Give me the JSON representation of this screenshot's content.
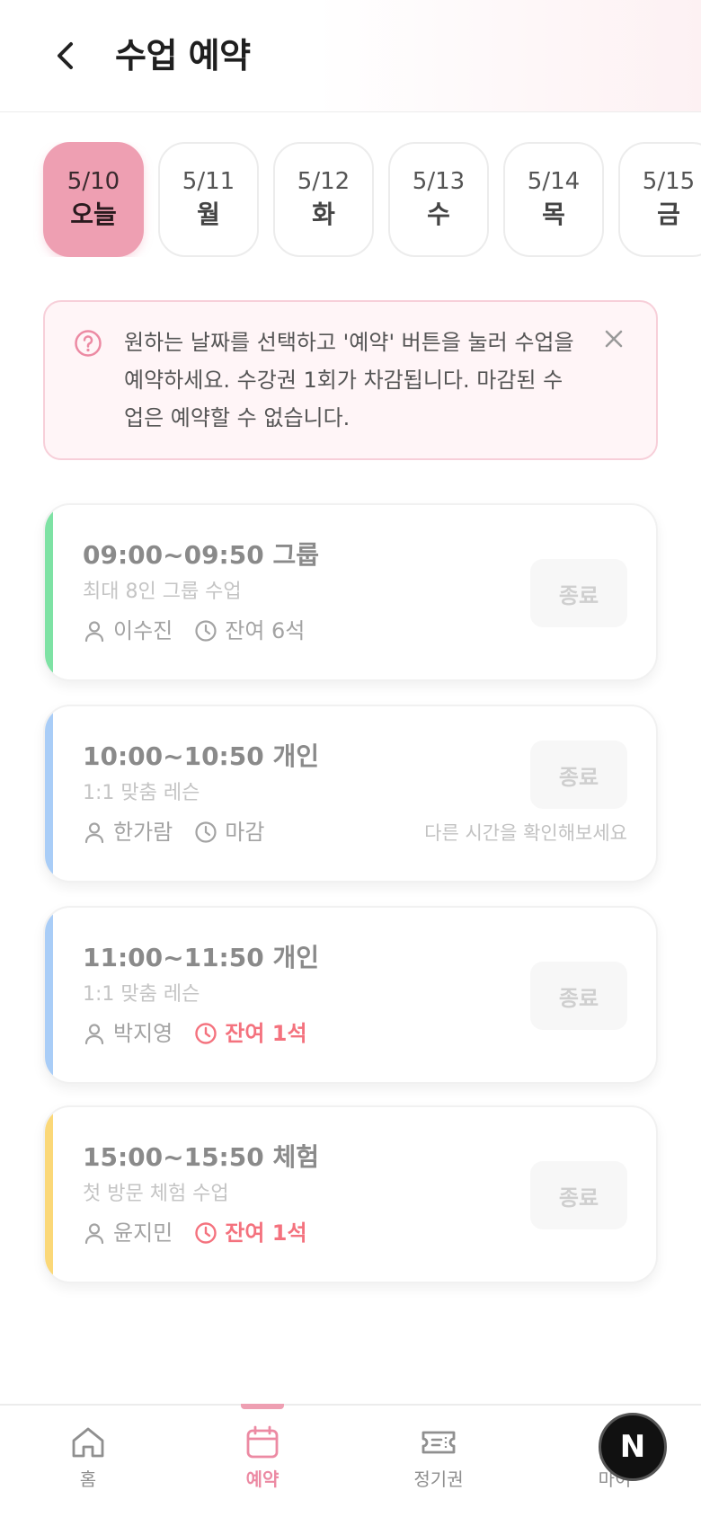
{
  "header": {
    "title": "수업 예약"
  },
  "dates": [
    {
      "date": "5/10",
      "weekday": "오늘"
    },
    {
      "date": "5/11",
      "weekday": "월"
    },
    {
      "date": "5/12",
      "weekday": "화"
    },
    {
      "date": "5/13",
      "weekday": "수"
    },
    {
      "date": "5/14",
      "weekday": "목"
    },
    {
      "date": "5/15",
      "weekday": "금"
    }
  ],
  "notice": {
    "text": "원하는 날짜를 선택하고 '예약' 버튼을 눌러 수업을 예약하세요. 수강권 1회가 차감됩니다. 마감된 수업은 예약할 수 없습니다."
  },
  "classes": [
    {
      "title": "09:00~09:50 그룹",
      "subtitle": "최대 8인 그룹 수업",
      "instructor": "이수진",
      "seats": "잔여 6석",
      "button": "종료",
      "accent": "#7ee2a4"
    },
    {
      "title": "10:00~10:50 개인",
      "subtitle": "1:1 맞춤 레슨",
      "instructor": "한가람",
      "seats": "마감",
      "button": "종료",
      "note": "다른 시간을 확인해보세요",
      "accent": "#a9cdf7"
    },
    {
      "title": "11:00~11:50 개인",
      "subtitle": "1:1 맞춤 레슨",
      "instructor": "박지영",
      "seats": "잔여 1석",
      "button": "종료",
      "accent": "#a9cdf7"
    },
    {
      "title": "15:00~15:50 체험",
      "subtitle": "첫 방문 체험 수업",
      "instructor": "윤지민",
      "seats": "잔여 1석",
      "button": "종료",
      "accent": "#fbd878"
    }
  ],
  "nav": {
    "items": [
      {
        "label": "홈",
        "icon": "home-icon"
      },
      {
        "label": "예약",
        "icon": "calendar-icon"
      },
      {
        "label": "정기권",
        "icon": "ticket-icon"
      },
      {
        "label": "마이",
        "icon": "user-icon"
      }
    ]
  },
  "badge": {
    "letter": "N"
  },
  "colors": {
    "brand": "#ee9fb2",
    "warn": "#f4727e"
  }
}
